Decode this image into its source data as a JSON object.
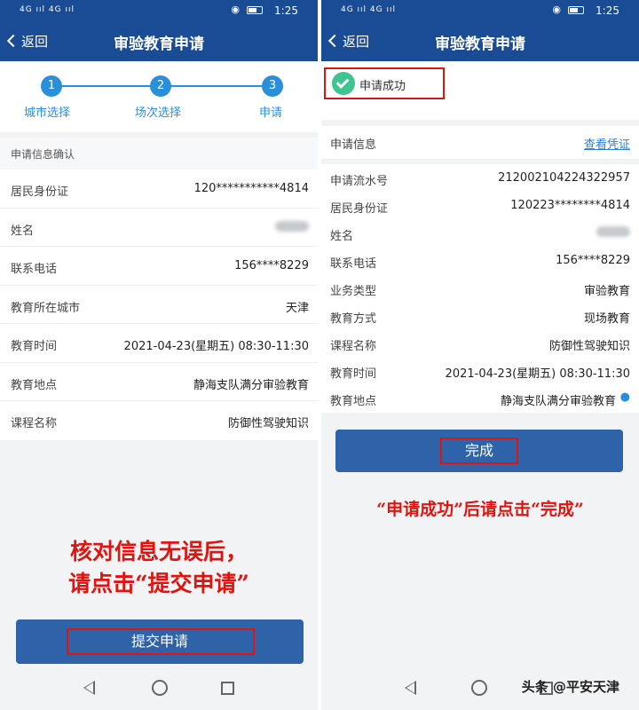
{
  "status": {
    "time": "1:25",
    "signal": "4G ııl 4G ııl"
  },
  "left": {
    "back_label": "返回",
    "title": "审验教育申请",
    "steps": [
      {
        "num": "1",
        "label": "城市选择"
      },
      {
        "num": "2",
        "label": "场次选择"
      },
      {
        "num": "3",
        "label": "申请"
      }
    ],
    "section_label": "申请信息确认",
    "rows": [
      {
        "k": "居民身份证",
        "v": "120***********4814"
      },
      {
        "k": "姓名",
        "v": ""
      },
      {
        "k": "联系电话",
        "v": "156****8229"
      },
      {
        "k": "教育所在城市",
        "v": "天津"
      },
      {
        "k": "教育时间",
        "v": "2021-04-23(星期五) 08:30-11:30"
      },
      {
        "k": "教育地点",
        "v": "静海支队满分审验教育"
      },
      {
        "k": "课程名称",
        "v": "防御性驾驶知识"
      }
    ],
    "note_line1": "核对信息无误后，",
    "note_line2": "请点击“提交申请”",
    "submit_label": "提交申请"
  },
  "right": {
    "back_label": "返回",
    "title": "审验教育申请",
    "success_label": "申请成功",
    "info_label": "申请信息",
    "view_voucher": "查看凭证",
    "rows": [
      {
        "k": "申请流水号",
        "v": "212002104224322957"
      },
      {
        "k": "居民身份证",
        "v": "120223********4814"
      },
      {
        "k": "姓名",
        "v": ""
      },
      {
        "k": "联系电话",
        "v": "156****8229"
      },
      {
        "k": "业务类型",
        "v": "审验教育"
      },
      {
        "k": "教育方式",
        "v": "现场教育"
      },
      {
        "k": "课程名称",
        "v": "防御性驾驶知识"
      },
      {
        "k": "教育时间",
        "v": "2021-04-23(星期五) 08:30-11:30"
      },
      {
        "k": "教育地点",
        "v": "静海支队满分审验教育"
      }
    ],
    "done_label": "完成",
    "note": "“申请成功”后请点击“完成”"
  },
  "watermark": "头条 @平安天津",
  "colors": {
    "header": "#1a4c96",
    "accent": "#2a8fd9",
    "button": "#2e63aa",
    "annotation": "#e0140f"
  }
}
